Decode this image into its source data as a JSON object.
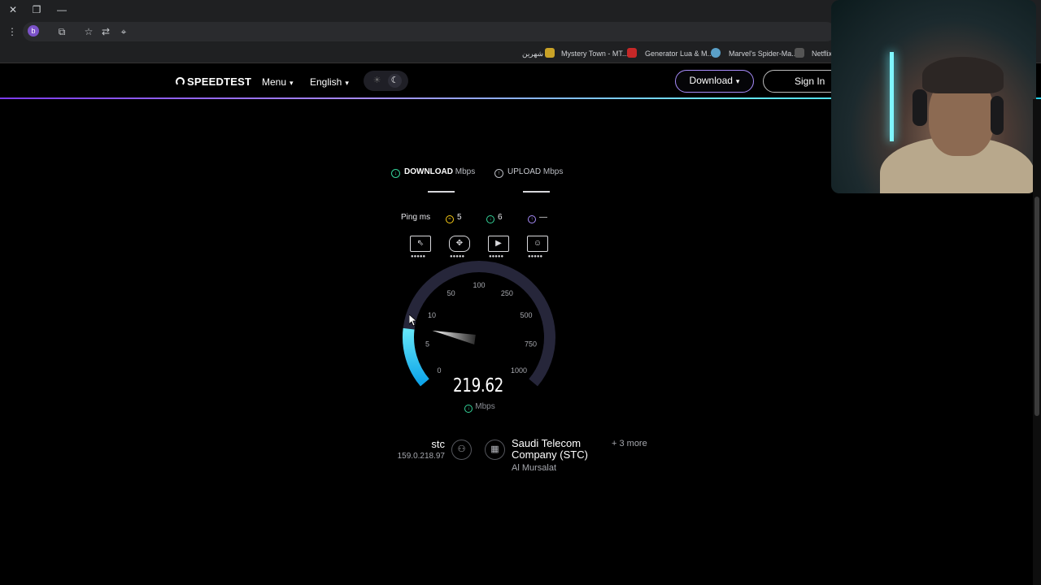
{
  "browser": {
    "profile_initial": "b",
    "bookmarks": [
      {
        "label": "شهرين",
        "color": "#c9a227"
      },
      {
        "label": "Mystery Town - MT...",
        "color": "#c62828"
      },
      {
        "label": "Generator Lua & M...",
        "color": "#5aa0c8"
      },
      {
        "label": "Marvel's Spider-Ma...",
        "color": "#555555"
      },
      {
        "label": "Netflix",
        "color": "#e50914"
      }
    ]
  },
  "header": {
    "logo": "SPEEDTEST",
    "menu_label": "Menu",
    "language_label": "English",
    "download_label": "Download",
    "signin_label": "Sign In"
  },
  "test": {
    "download_tab": {
      "label": "DOWNLOAD",
      "unit": "Mbps"
    },
    "upload_tab": {
      "label": "UPLOAD",
      "unit": "Mbps"
    },
    "ping": {
      "label": "Ping ms",
      "idle": "5",
      "download": "6",
      "upload": "—"
    },
    "gauge": {
      "ticks": [
        "0",
        "5",
        "10",
        "50",
        "100",
        "250",
        "500",
        "750",
        "1000"
      ],
      "needle_value": 219.62,
      "accent": "#22d3ee"
    },
    "speed_value": "219.62",
    "speed_unit": "Mbps"
  },
  "connection": {
    "isp": "stc",
    "ip": "159.0.218.97",
    "server_name": "Saudi Telecom Company (STC)",
    "server_location": "Al Mursalat",
    "more_servers": "+ 3 more"
  },
  "colors": {
    "download": "#34d399",
    "upload": "#a78bfa",
    "idle_ping": "#facc15",
    "accent_gradient_start": "#7c3aed",
    "accent_gradient_end": "#22d3ee"
  }
}
